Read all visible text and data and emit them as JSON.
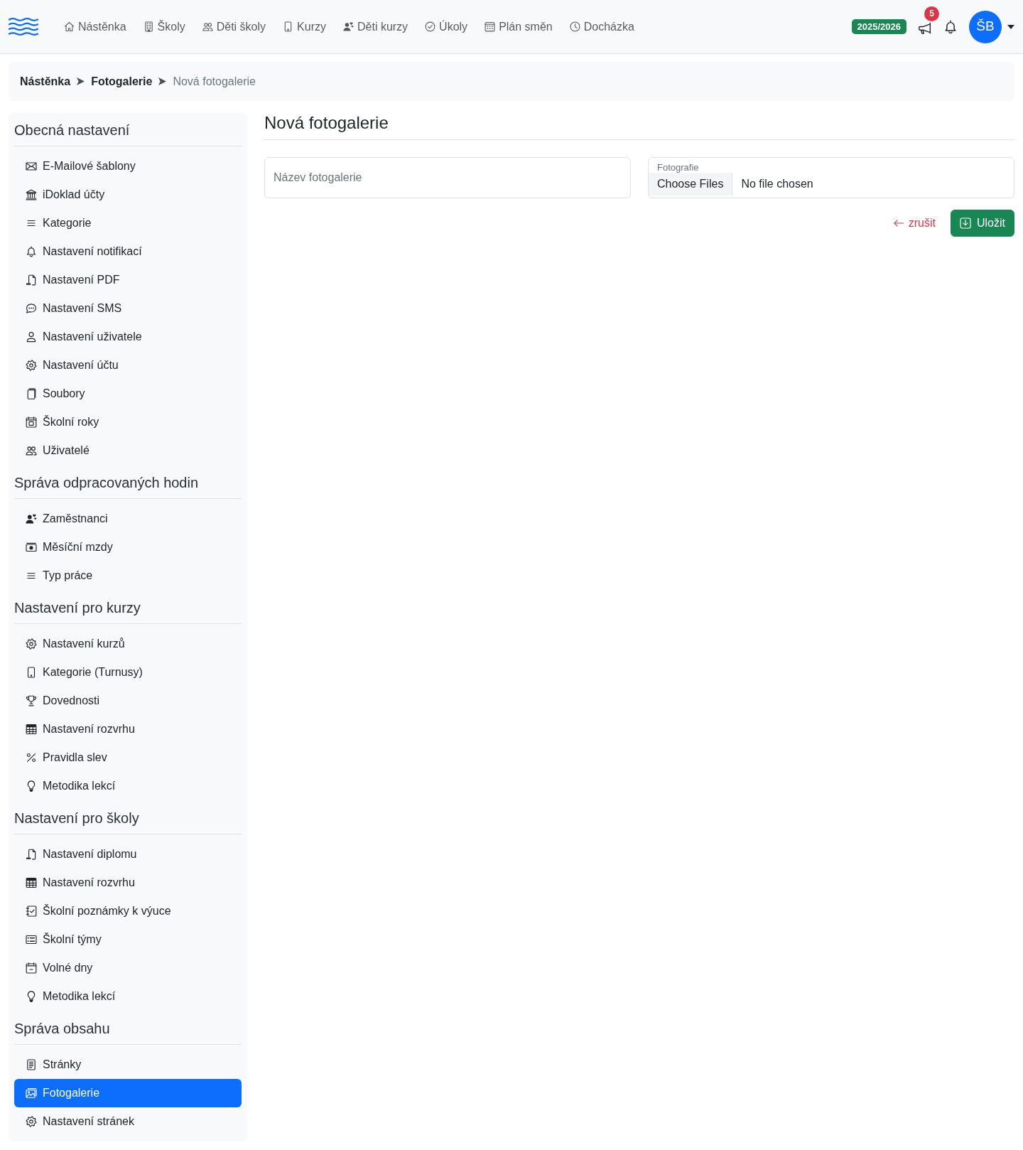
{
  "navbar": {
    "links": [
      "Nástěnka",
      "Školy",
      "Děti školy",
      "Kurzy",
      "Děti kurzy",
      "Úkoly",
      "Plán směn",
      "Docházka"
    ],
    "school_year": "2025/2026",
    "announcements_count": "5",
    "avatar_initials": "ŠB"
  },
  "breadcrumb": [
    {
      "label": "Nástěnka",
      "current": false
    },
    {
      "label": "Fotogalerie",
      "current": false
    },
    {
      "label": "Nová fotogalerie",
      "current": true
    }
  ],
  "sidebar": {
    "sections": [
      {
        "title": "Obecná nastavení",
        "items": [
          {
            "label": "E-Mailové šablony",
            "selected": false
          },
          {
            "label": "iDoklad účty",
            "selected": false
          },
          {
            "label": "Kategorie",
            "selected": false
          },
          {
            "label": "Nastavení notifikací",
            "selected": false
          },
          {
            "label": "Nastavení PDF",
            "selected": false
          },
          {
            "label": "Nastavení SMS",
            "selected": false
          },
          {
            "label": "Nastavení uživatele",
            "selected": false
          },
          {
            "label": "Nastavení účtu",
            "selected": false
          },
          {
            "label": "Soubory",
            "selected": false
          },
          {
            "label": "Školní roky",
            "selected": false
          },
          {
            "label": "Uživatelé",
            "selected": false
          }
        ]
      },
      {
        "title": "Správa odpracovaných hodin",
        "items": [
          {
            "label": "Zaměstnanci",
            "selected": false
          },
          {
            "label": "Měsíční mzdy",
            "selected": false
          },
          {
            "label": "Typ práce",
            "selected": false
          }
        ]
      },
      {
        "title": "Nastavení pro kurzy",
        "items": [
          {
            "label": "Nastavení kurzů",
            "selected": false
          },
          {
            "label": "Kategorie (Turnusy)",
            "selected": false
          },
          {
            "label": "Dovednosti",
            "selected": false
          },
          {
            "label": "Nastavení rozvrhu",
            "selected": false
          },
          {
            "label": "Pravidla slev",
            "selected": false
          },
          {
            "label": "Metodika lekcí",
            "selected": false
          }
        ]
      },
      {
        "title": "Nastavení pro školy",
        "items": [
          {
            "label": "Nastavení diplomu",
            "selected": false
          },
          {
            "label": "Nastavení rozvrhu",
            "selected": false
          },
          {
            "label": "Školní poznámky k výuce",
            "selected": false
          },
          {
            "label": "Školní týmy",
            "selected": false
          },
          {
            "label": "Volné dny",
            "selected": false
          },
          {
            "label": "Metodika lekcí",
            "selected": false
          }
        ]
      },
      {
        "title": "Správa obsahu",
        "items": [
          {
            "label": "Stránky",
            "selected": false
          },
          {
            "label": "Fotogalerie",
            "selected": true
          },
          {
            "label": "Nastavení stránek",
            "selected": false
          }
        ]
      }
    ]
  },
  "main": {
    "title": "Nová fotogalerie",
    "name_field": {
      "placeholder": "Název fotogalerie"
    },
    "photos_field": {
      "label": "Fotografie",
      "button": "Choose Files",
      "status": "No file chosen"
    },
    "cancel_link": "zrušit",
    "save_button": "Uložit"
  }
}
